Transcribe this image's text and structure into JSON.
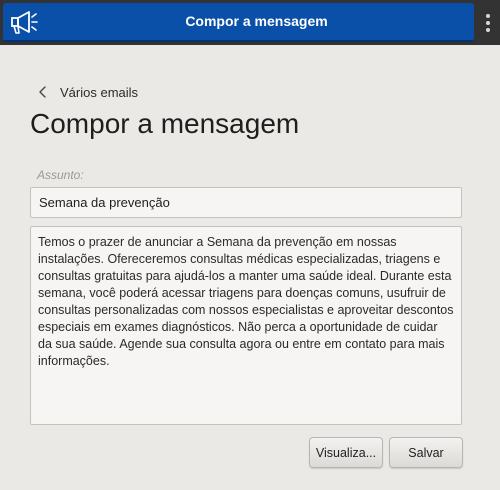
{
  "window": {
    "title": "Compor a mensagem"
  },
  "icons": {
    "app": "megaphone-icon",
    "menu": "kebab-menu-icon",
    "back": "chevron-left-icon"
  },
  "colors": {
    "titlebar": "#0a4fa8",
    "background": "#ebe9e6",
    "frame": "#333333"
  },
  "nav": {
    "back_label": "Vários emails"
  },
  "page": {
    "title": "Compor a mensagem"
  },
  "form": {
    "subject_label": "Assunto:",
    "subject_value": "Semana da prevenção",
    "body_value": "Temos o prazer de anunciar a Semana da prevenção em nossas instalações. Ofereceremos consultas médicas especializadas, triagens e consultas gratuitas para ajudá-los a manter uma saúde ideal. Durante esta semana, você poderá acessar triagens para doenças comuns, usufruir de consultas personalizadas com nossos especialistas e aproveitar descontos especiais em exames diagnósticos. Não perca a oportunidade de cuidar da sua saúde. Agende sua consulta agora ou entre em contato para mais informações."
  },
  "actions": {
    "preview_label": "Visualiza...",
    "save_label": "Salvar"
  }
}
